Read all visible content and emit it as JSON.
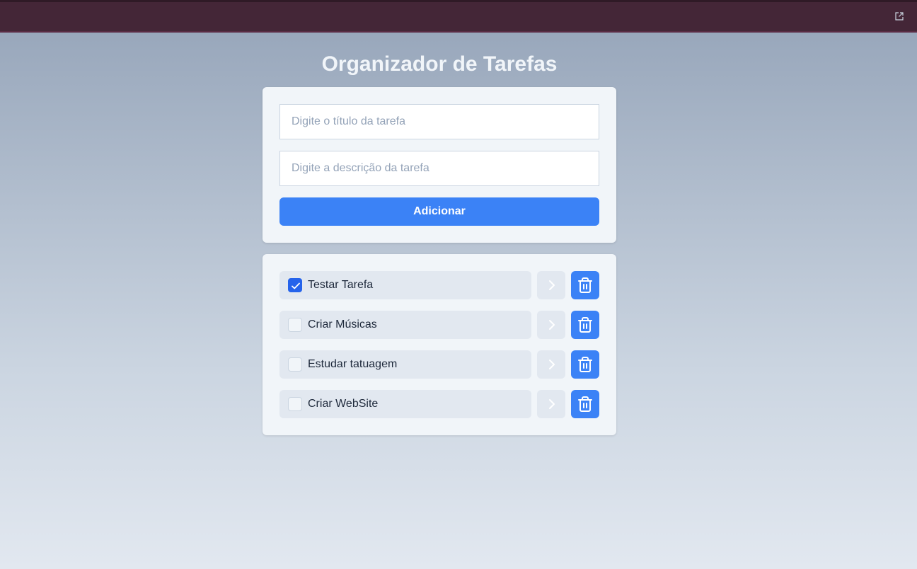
{
  "app": {
    "title": "Organizador de Tarefas"
  },
  "form": {
    "title_placeholder": "Digite o título da tarefa",
    "title_value": "",
    "description_placeholder": "Digite a descrição da tarefa",
    "description_value": "",
    "add_label": "Adicionar"
  },
  "tasks": [
    {
      "title": "Testar Tarefa",
      "completed": true
    },
    {
      "title": "Criar Músicas",
      "completed": false
    },
    {
      "title": "Estudar tatuagem",
      "completed": false
    },
    {
      "title": "Criar WebSite",
      "completed": false
    }
  ],
  "icons": {
    "details": "chevron-right-icon",
    "delete": "trash-icon",
    "check": "check-icon",
    "toolbar": "edit-external-icon"
  },
  "colors": {
    "primary": "#3b82f6",
    "checked": "#2563eb",
    "card": "#f1f5f9",
    "row": "#e2e8f0",
    "top_bar": "#442637"
  }
}
